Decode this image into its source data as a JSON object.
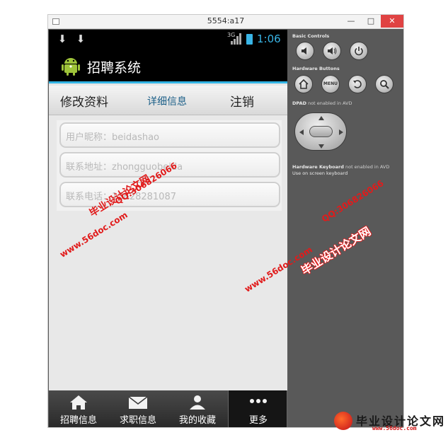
{
  "window": {
    "title": "5554:a17",
    "minimize_label": "—",
    "maximize_label": "□",
    "close_label": "✕"
  },
  "statusbar": {
    "network": "3G",
    "time": "1:06"
  },
  "actionbar": {
    "app_title": "招聘系统"
  },
  "tabs": [
    {
      "label": "修改资料"
    },
    {
      "label": "详细信息"
    },
    {
      "label": "注销"
    }
  ],
  "form": {
    "nickname": "用户昵称：beidashao",
    "address": "联系地址：zhongguobeida",
    "phone": "联系电话：13628281087"
  },
  "bottom_nav": [
    {
      "label": "招聘信息",
      "icon": "home-icon"
    },
    {
      "label": "求职信息",
      "icon": "mail-icon"
    },
    {
      "label": "我的收藏",
      "icon": "person-icon"
    },
    {
      "label": "更多",
      "icon": "more-icon",
      "active": true
    }
  ],
  "controls": {
    "basic_heading": "Basic Controls",
    "hardware_heading": "Hardware Buttons",
    "menu_label": "MENU",
    "dpad_heading": "DPAD",
    "dpad_note": "not enabled in AVD",
    "keyboard_heading": "Hardware Keyboard",
    "keyboard_note": "not enabled in AVD",
    "keyboard_note2": "Use on screen keyboard"
  },
  "watermarks": {
    "site_name": "毕业设计论文网",
    "site_url": "www.56doc.com",
    "qq": "QQ:306826066"
  },
  "logo": {
    "title": "毕业设计论文网",
    "url": "www.56doc.com"
  },
  "colors": {
    "accent": "#33b5e5",
    "watermark": "#e11b1b"
  }
}
